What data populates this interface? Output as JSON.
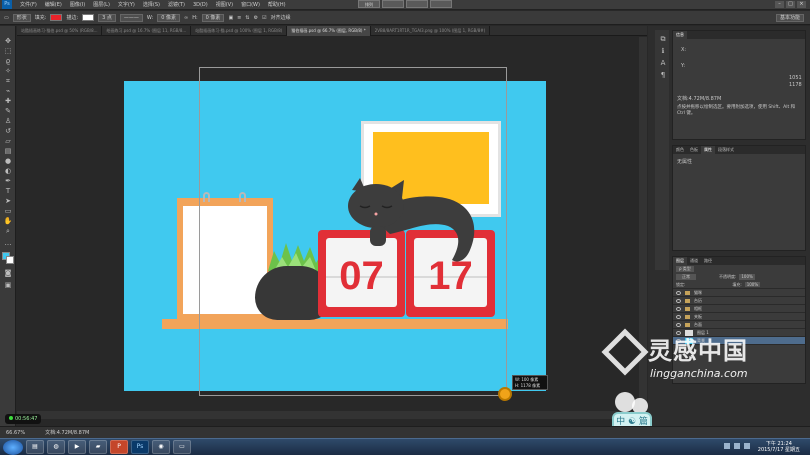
{
  "menubar": {
    "logo": "Ps",
    "items": [
      "文件(F)",
      "编辑(E)",
      "图像(I)",
      "图层(L)",
      "文字(Y)",
      "选择(S)",
      "滤镜(T)",
      "3D(D)",
      "视图(V)",
      "窗口(W)",
      "帮助(H)"
    ],
    "center_buttons": [
      "排列",
      "",
      "",
      ""
    ],
    "window_buttons": [
      "–",
      "□",
      "×"
    ]
  },
  "options": {
    "shape_mode": "形状",
    "fill_label": "填充:",
    "stroke_label": "描边:",
    "stroke_size": "3 点",
    "w_label": "W:",
    "w_value": "0 像素",
    "h_label": "H:",
    "h_value": "0 像素",
    "align_edges": "对齐边缘",
    "workspace": "基本功能"
  },
  "tabs": [
    {
      "label": "站酷插画练习-猫伯.psd @ 50% (RGB/8...",
      "active": false
    },
    {
      "label": "绘画练习.psd @ 16.7% (图层 11, RGB/8...",
      "active": false
    },
    {
      "label": "站酷插画练习-猫.psd @ 100% (图层 1, RGB/8)",
      "active": false
    },
    {
      "label": "猫伯插画.psd @ 66.7% (图层, RGB/8) *",
      "active": true
    },
    {
      "label": "2VB8/8ART1RT1R_TGAI3.png @ 100% (图层 1, RGB/8#)",
      "active": false
    }
  ],
  "scene": {
    "calendar_left": "07",
    "calendar_right": "17"
  },
  "info_popup": {
    "w": "W: 100 像素",
    "h": "H: 1178 像素"
  },
  "timer": "00:56:47",
  "status": {
    "zoom": "66.67%",
    "doc": "文档:4.72M/8.87M"
  },
  "panels": {
    "info": {
      "tabs": [
        "信息"
      ],
      "x": "X:",
      "y": "Y:",
      "w_val": "1051",
      "h_val": "1178",
      "doc": "文档:4.72M/8.87M",
      "hint": "点按并拖移以绘制选区。要用附加选项，使用 Shift、Alt 和 Ctrl 键。"
    },
    "props": {
      "tabs": [
        "颜色",
        "色板",
        "属性",
        "段落样式"
      ],
      "active": "属性",
      "body": "无属性"
    },
    "layers": {
      "tabs": [
        "图层",
        "通道",
        "路径"
      ],
      "kind": "ρ 类型",
      "blend": "正常",
      "opacity_label": "不透明度:",
      "opacity": "100%",
      "lock_label": "锁定:",
      "fill_label": "填充:",
      "fill": "100%",
      "rows": [
        {
          "name": "猫咪",
          "selected": false
        },
        {
          "name": "台历",
          "selected": false
        },
        {
          "name": "相框",
          "selected": false
        },
        {
          "name": "夹板",
          "selected": false
        },
        {
          "name": "台面",
          "selected": false
        },
        {
          "name": "图层 1",
          "selected": false
        },
        {
          "name": "背景",
          "selected": true
        }
      ]
    }
  },
  "watermark": {
    "title": "灵感中国",
    "url": "lingganchina.com",
    "badge": "中 ☯ 篇"
  },
  "taskbar": {
    "apps": [
      "",
      "",
      "",
      "",
      "",
      "",
      "",
      ""
    ],
    "time": "下午 21:24",
    "date": "2015/7/17 星期五"
  }
}
